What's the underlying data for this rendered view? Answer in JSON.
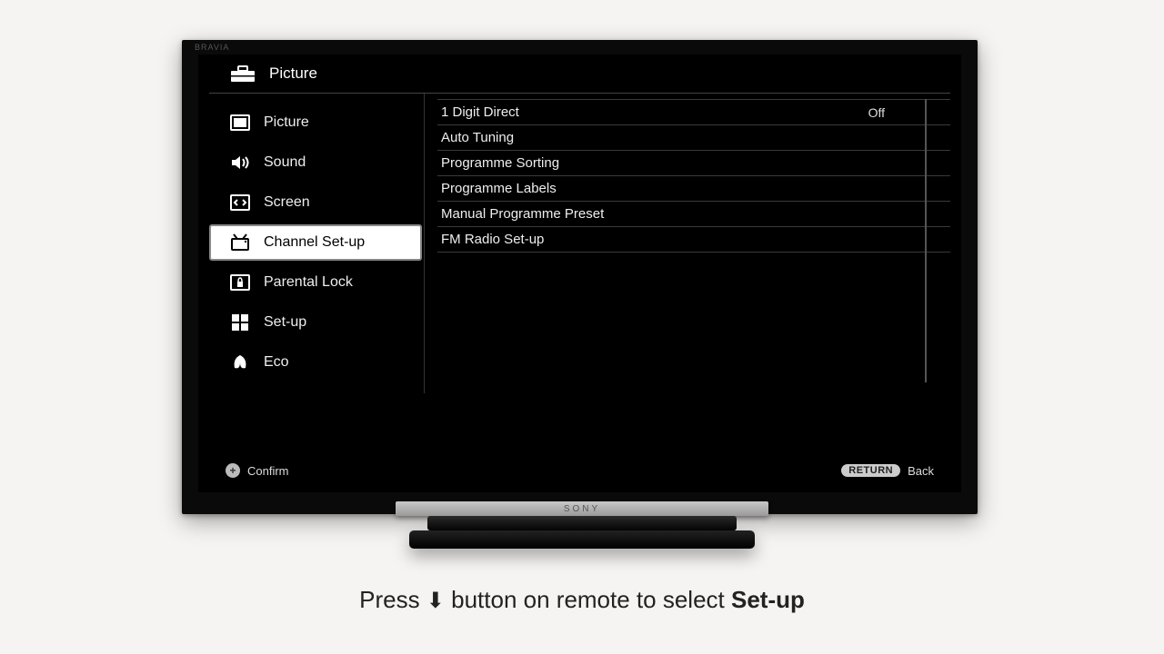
{
  "tv_brand": "BRAVIA",
  "tv_logo": "SONY",
  "header": {
    "title": "Picture"
  },
  "sidebar": {
    "items": [
      {
        "label": "Picture",
        "icon": "picture-icon",
        "selected": false
      },
      {
        "label": "Sound",
        "icon": "sound-icon",
        "selected": false
      },
      {
        "label": "Screen",
        "icon": "screen-icon",
        "selected": false
      },
      {
        "label": "Channel Set-up",
        "icon": "channel-icon",
        "selected": true
      },
      {
        "label": "Parental Lock",
        "icon": "lock-icon",
        "selected": false
      },
      {
        "label": "Set-up",
        "icon": "setup-icon",
        "selected": false
      },
      {
        "label": "Eco",
        "icon": "eco-icon",
        "selected": false
      }
    ]
  },
  "options": [
    {
      "label": "1 Digit Direct",
      "value": "Off"
    },
    {
      "label": "Auto Tuning",
      "value": ""
    },
    {
      "label": "Programme Sorting",
      "value": ""
    },
    {
      "label": "Programme Labels",
      "value": ""
    },
    {
      "label": "Manual Programme Preset",
      "value": ""
    },
    {
      "label": "FM Radio Set-up",
      "value": ""
    }
  ],
  "footer": {
    "confirm_label": "Confirm",
    "return_chip": "RETURN",
    "back_label": "Back"
  },
  "caption": {
    "prefix": "Press ",
    "arrow": "⬇",
    "middle": " button on remote to select ",
    "bold": "Set-up"
  }
}
